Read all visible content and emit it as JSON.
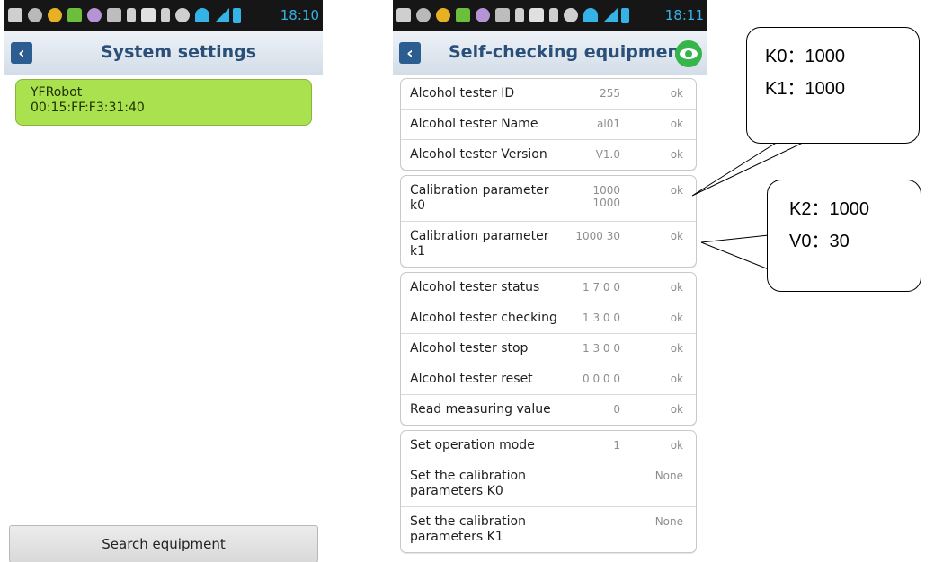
{
  "status_bar": {
    "time_left": "18:10",
    "time_right": "18:11"
  },
  "left_screen": {
    "title": "System settings",
    "device": {
      "name": "YFRobot",
      "address": "00:15:FF:F3:31:40"
    },
    "search_button": "Search equipment"
  },
  "right_screen": {
    "title": "Self-checking equipment",
    "groups": [
      {
        "rows": [
          {
            "label": "Alcohol tester ID",
            "value": "255",
            "status": "ok"
          },
          {
            "label": "Alcohol tester Name",
            "value": "al01",
            "status": "ok"
          },
          {
            "label": "Alcohol tester Version",
            "value": "V1.0",
            "status": "ok"
          }
        ]
      },
      {
        "rows": [
          {
            "label": "Calibration parameter k0",
            "value": "1000\n1000",
            "status": "ok"
          },
          {
            "label": "Calibration parameter k1",
            "value": "1000 30",
            "status": "ok"
          }
        ]
      },
      {
        "rows": [
          {
            "label": "Alcohol tester status",
            "value": "1 7 0 0",
            "status": "ok"
          },
          {
            "label": "Alcohol tester checking",
            "value": "1 3 0 0",
            "status": "ok"
          },
          {
            "label": "Alcohol tester stop",
            "value": "1 3 0 0",
            "status": "ok"
          },
          {
            "label": "Alcohol tester reset",
            "value": "0 0 0 0",
            "status": "ok"
          },
          {
            "label": "Read measuring value",
            "value": "0",
            "status": "ok"
          }
        ]
      },
      {
        "rows": [
          {
            "label": "Set operation mode",
            "value": "1",
            "status": "ok"
          },
          {
            "label": "Set the calibration parameters K0",
            "value": "",
            "status": "None"
          },
          {
            "label": "Set the calibration parameters K1",
            "value": "",
            "status": "None"
          }
        ]
      }
    ]
  },
  "callouts": [
    {
      "lines": [
        "K0：1000",
        "K1：1000"
      ]
    },
    {
      "lines": [
        "K2：1000",
        "V0：30"
      ]
    }
  ],
  "colors": {
    "status_bar": "#161616",
    "accent_blue": "#36b3e6",
    "title_text": "#2a4f78",
    "bubble_green": "#a9e14f",
    "eye_green": "#36b54a"
  }
}
